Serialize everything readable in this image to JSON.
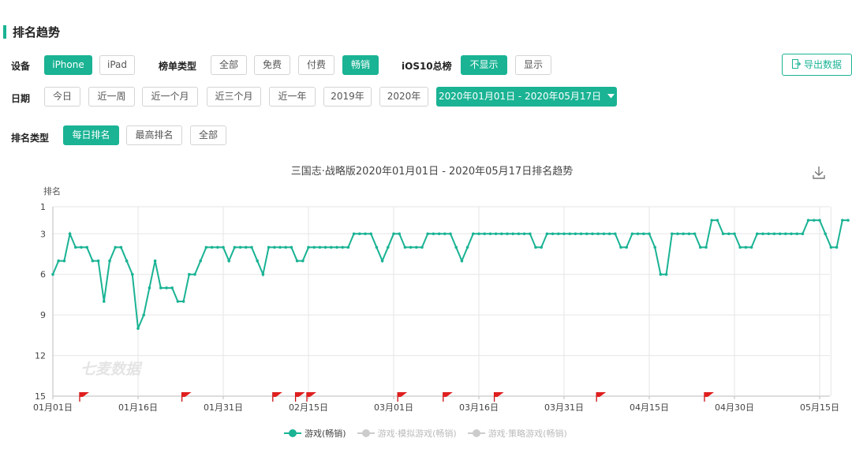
{
  "section_title": "排名趋势",
  "filters": {
    "device": {
      "label": "设备",
      "options": [
        "iPhone",
        "iPad"
      ],
      "selected": "iPhone"
    },
    "list_type": {
      "label": "榜单类型",
      "options": [
        "全部",
        "免费",
        "付费",
        "畅销"
      ],
      "selected": "畅销"
    },
    "ios10": {
      "label": "iOS10总榜",
      "options": [
        "不显示",
        "显示"
      ],
      "selected": "不显示"
    },
    "date": {
      "label": "日期",
      "options": [
        "今日",
        "近一周",
        "近一个月",
        "近三个月",
        "近一年",
        "2019年",
        "2020年"
      ],
      "range": "2020年01月01日 - 2020年05月17日"
    },
    "rank_type": {
      "label": "排名类型",
      "options": [
        "每日排名",
        "最高排名",
        "全部"
      ],
      "selected": "每日排名"
    }
  },
  "export_label": "导出数据",
  "icons": {
    "export": "export-icon",
    "download": "download-icon",
    "dropdown": "caret-down-icon",
    "flag": "flag-icon"
  },
  "colors": {
    "accent": "#1ab394",
    "flag": "#e01e1e",
    "inactive": "#cccccc"
  },
  "watermark": "七麦数据",
  "chart_data": {
    "type": "line",
    "title": "三国志·战略版2020年01月01日 - 2020年05月17日排名趋势",
    "ylabel": "排名",
    "y_inverted": true,
    "ylim": [
      1,
      15
    ],
    "y_ticks": [
      "1",
      "3",
      "6",
      "9",
      "12",
      "15"
    ],
    "x_ticks": [
      "01月01日",
      "01月16日",
      "01月31日",
      "02月15日",
      "03月01日",
      "03月16日",
      "03月31日",
      "04月15日",
      "04月30日",
      "05月15日"
    ],
    "x_start": "2020-01-01",
    "x_end": "2020-05-17",
    "grid": true,
    "legend_position": "bottom",
    "series": [
      {
        "name": "游戏(畅销)",
        "color": "#1ab394",
        "active": true,
        "values": [
          6,
          5,
          5,
          3,
          4,
          4,
          4,
          5,
          5,
          8,
          5,
          4,
          4,
          5,
          6,
          10,
          9,
          7,
          5,
          7,
          7,
          7,
          8,
          8,
          6,
          6,
          5,
          4,
          4,
          4,
          4,
          5,
          4,
          4,
          4,
          4,
          5,
          6,
          4,
          4,
          4,
          4,
          4,
          5,
          5,
          4,
          4,
          4,
          4,
          4,
          4,
          4,
          4,
          3,
          3,
          3,
          3,
          4,
          5,
          4,
          3,
          3,
          4,
          4,
          4,
          4,
          3,
          3,
          3,
          3,
          3,
          4,
          5,
          4,
          3,
          3,
          3,
          3,
          3,
          3,
          3,
          3,
          3,
          3,
          3,
          4,
          4,
          3,
          3,
          3,
          3,
          3,
          3,
          3,
          3,
          3,
          3,
          3,
          3,
          3,
          4,
          4,
          3,
          3,
          3,
          3,
          4,
          6,
          6,
          3,
          3,
          3,
          3,
          3,
          4,
          4,
          2,
          2,
          3,
          3,
          3,
          4,
          4,
          4,
          3,
          3,
          3,
          3,
          3,
          3,
          3,
          3,
          3,
          2,
          2,
          2,
          3,
          4,
          4,
          2,
          2
        ]
      },
      {
        "name": "游戏·模拟游戏(畅销)",
        "color": "#cccccc",
        "active": false,
        "values": []
      },
      {
        "name": "游戏·策略游戏(畅销)",
        "color": "#cccccc",
        "active": false,
        "values": []
      }
    ],
    "flag_days": [
      5,
      23,
      39,
      43,
      45,
      61,
      69,
      78,
      96,
      115
    ]
  }
}
